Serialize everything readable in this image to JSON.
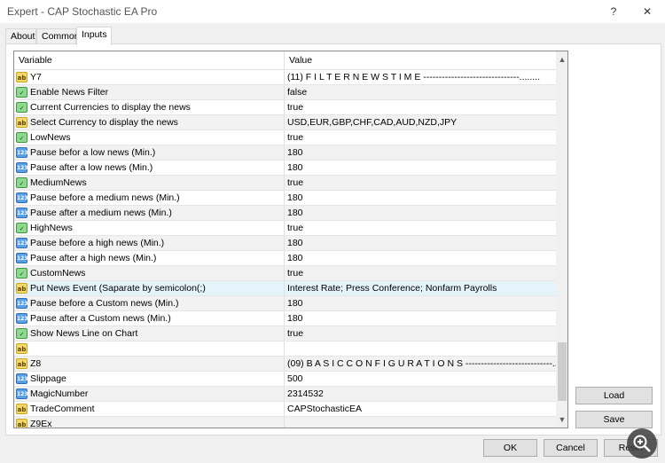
{
  "window": {
    "title": "Expert - CAP Stochastic EA Pro",
    "help_label": "?",
    "close_label": "✕"
  },
  "tabs": [
    {
      "label": "About"
    },
    {
      "label": "Common"
    },
    {
      "label": "Inputs"
    }
  ],
  "table": {
    "col_variable": "Variable",
    "col_value": "Value",
    "rows": [
      {
        "icon": "ab",
        "name": "Y7",
        "value": "(11) F I L T E R  N E W S  T I M E -------------------------------........"
      },
      {
        "icon": "bool",
        "name": "Enable News Filter",
        "value": "false"
      },
      {
        "icon": "bool",
        "name": "Current Currencies to display the news",
        "value": "true"
      },
      {
        "icon": "ab",
        "name": "Select Currency to display the news",
        "value": "USD,EUR,GBP,CHF,CAD,AUD,NZD,JPY"
      },
      {
        "icon": "bool",
        "name": "LowNews",
        "value": "true"
      },
      {
        "icon": "num",
        "name": "Pause befor a low news (Min.)",
        "value": "180"
      },
      {
        "icon": "num",
        "name": "Pause after a low news (Min.)",
        "value": "180"
      },
      {
        "icon": "bool",
        "name": "MediumNews",
        "value": "true"
      },
      {
        "icon": "num",
        "name": "Pause before a medium news (Min.)",
        "value": "180"
      },
      {
        "icon": "num",
        "name": "Pause after a medium news (Min.)",
        "value": "180"
      },
      {
        "icon": "bool",
        "name": "HighNews",
        "value": "true"
      },
      {
        "icon": "num",
        "name": "Pause before a high news (Min.)",
        "value": "180"
      },
      {
        "icon": "num",
        "name": "Pause after a high news (Min.)",
        "value": "180"
      },
      {
        "icon": "bool",
        "name": "CustomNews",
        "value": "true"
      },
      {
        "icon": "ab",
        "name": "Put News Event (Saparate by semicolon(;)",
        "value": "Interest Rate; Press Conference; Nonfarm Payrolls"
      },
      {
        "icon": "num",
        "name": "Pause before a Custom news (Min.)",
        "value": "180"
      },
      {
        "icon": "num",
        "name": "Pause after a Custom news (Min.)",
        "value": "180"
      },
      {
        "icon": "bool",
        "name": "Show News Line on Chart",
        "value": "true"
      },
      {
        "icon": "ab",
        "name": "",
        "value": ""
      },
      {
        "icon": "ab",
        "name": "Z8",
        "value": "(09)  B A S I C   C O N F I G U R A T I O N S ----------------------------..."
      },
      {
        "icon": "num",
        "name": "Slippage",
        "value": "500"
      },
      {
        "icon": "num",
        "name": "MagicNumber",
        "value": "2314532"
      },
      {
        "icon": "ab",
        "name": "TradeComment",
        "value": "CAPStochasticEA"
      },
      {
        "icon": "ab",
        "name": "Z9Ex",
        "value": ""
      }
    ]
  },
  "side_buttons": {
    "load": "Load",
    "save": "Save"
  },
  "footer_buttons": {
    "ok": "OK",
    "cancel": "Cancel",
    "reset": "Reset"
  },
  "icons": {
    "string": "ab-icon",
    "number": "123-icon",
    "bool": "chart-toggle-icon",
    "zoom": "zoom-in-icon"
  },
  "selected_row_index": 14
}
